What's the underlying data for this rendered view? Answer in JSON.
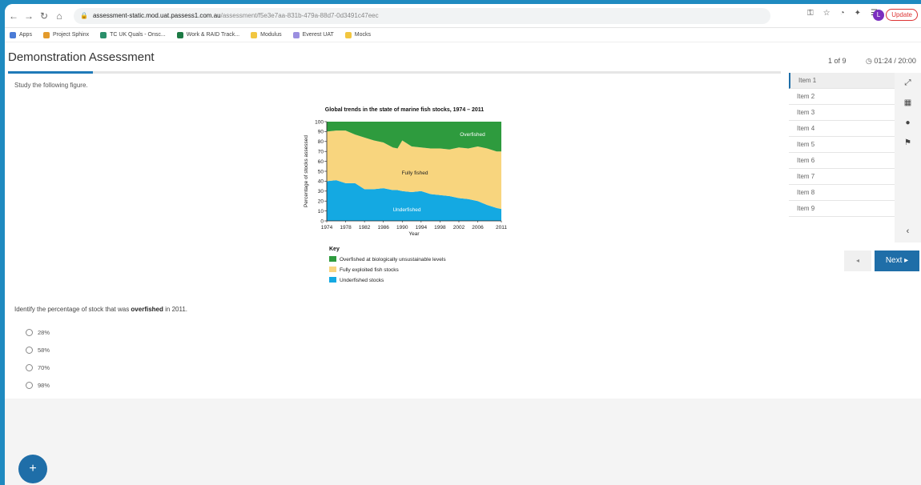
{
  "browser": {
    "url_host": "assessment-static.mod.uat.passess1.com.au",
    "url_path": "/assessment/f5e3e7aa-831b-479a-88d7-0d3491c47eec",
    "update_label": "Update",
    "profile_initial": "L",
    "bookmarks": [
      "Apps",
      "Project Sphinx",
      "TC UK Quals - Onsc...",
      "Work & RAID Track...",
      "Modulus",
      "Everest UAT",
      "Mocks"
    ]
  },
  "header": {
    "title": "Demonstration Assessment",
    "counter": "1 of 9",
    "timer": "01:24 / 20:00"
  },
  "progress": {
    "fraction": 0.11
  },
  "question": {
    "prompt": "Study the following figure.",
    "stem_before": "Identify the percentage of stock that was ",
    "stem_bold": "overfished",
    "stem_after": " in 2011.",
    "options": [
      "28%",
      "58%",
      "70%",
      "98%"
    ]
  },
  "items": [
    "Item 1",
    "Item 2",
    "Item 3",
    "Item 4",
    "Item 5",
    "Item 6",
    "Item 7",
    "Item 8",
    "Item 9"
  ],
  "navigation": {
    "next_label": "Next ▸",
    "prev_label": "◂"
  },
  "fab_label": "+",
  "tool_icons": [
    "fullscreen-icon",
    "calculator-icon",
    "info-icon",
    "flag-icon"
  ],
  "colors": {
    "accent": "#1f6ea8",
    "overfished": "#2e9b3e",
    "fully_fished": "#f8d57e",
    "underfished": "#14a9e2"
  },
  "chart_data": {
    "type": "area",
    "title": "Global trends in the state of marine fish stocks, 1974 – 2011",
    "xlabel": "Year",
    "ylabel": "Percentage of stocks assessed",
    "xlim": [
      1974,
      2011
    ],
    "ylim": [
      0,
      100
    ],
    "x_ticks": [
      "1974",
      "1978",
      "1982",
      "1986",
      "1990",
      "1994",
      "1998",
      "2002",
      "2006",
      "2011"
    ],
    "y_ticks": [
      "0",
      "10",
      "20",
      "30",
      "40",
      "50",
      "60",
      "70",
      "80",
      "90",
      "100"
    ],
    "x": [
      1974,
      1976,
      1978,
      1980,
      1982,
      1984,
      1986,
      1988,
      1989,
      1990,
      1992,
      1994,
      1996,
      1998,
      2000,
      2002,
      2004,
      2006,
      2008,
      2010,
      2011
    ],
    "stack_order": [
      "Underfished",
      "Fully fished",
      "Overfished"
    ],
    "series": [
      {
        "name": "Underfished",
        "values": [
          40,
          41,
          38,
          38,
          32,
          32,
          33,
          31,
          31,
          30,
          29,
          30,
          27,
          26,
          25,
          23,
          22,
          20,
          16,
          13,
          12
        ]
      },
      {
        "name": "Fully fished",
        "values": [
          50,
          50,
          53,
          49,
          52,
          49,
          46,
          43,
          42,
          51,
          46,
          44,
          46,
          47,
          47,
          51,
          51,
          55,
          57,
          57,
          58
        ]
      },
      {
        "name": "Overfished",
        "values": [
          10,
          9,
          9,
          13,
          16,
          19,
          21,
          26,
          27,
          19,
          25,
          26,
          27,
          27,
          28,
          26,
          27,
          25,
          27,
          30,
          30
        ]
      }
    ],
    "area_labels": [
      "Overfished",
      "Fully fished",
      "Underfished"
    ],
    "key_title": "Key",
    "legend": [
      {
        "label": "Overfished at biologically unsustainable levels",
        "color": "#2e9b3e"
      },
      {
        "label": "Fully exploited fish stocks",
        "color": "#f8d57e"
      },
      {
        "label": "Underfished stocks",
        "color": "#14a9e2"
      }
    ]
  }
}
